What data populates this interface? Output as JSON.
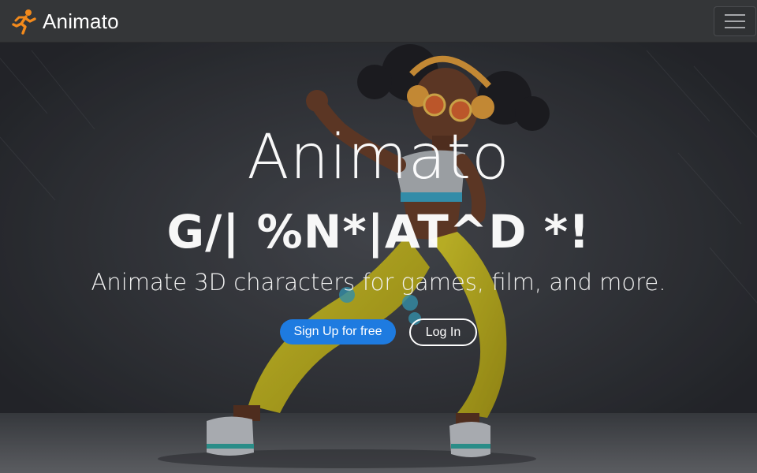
{
  "navbar": {
    "brand_name": "Animato",
    "brand_icon": "running-person-icon",
    "brand_color": "#f28a1c",
    "menu_icon": "hamburger-menu-icon"
  },
  "hero": {
    "title": "Animato",
    "glitch_text": "G/| %N*|AT^D *!",
    "subtitle": "Animate 3D characters for games, film, and more.",
    "signup_label": "Sign Up for free",
    "login_label": "Log In",
    "background_image": "3d-dancing-character-image",
    "accent_color": "#1e7be0"
  }
}
